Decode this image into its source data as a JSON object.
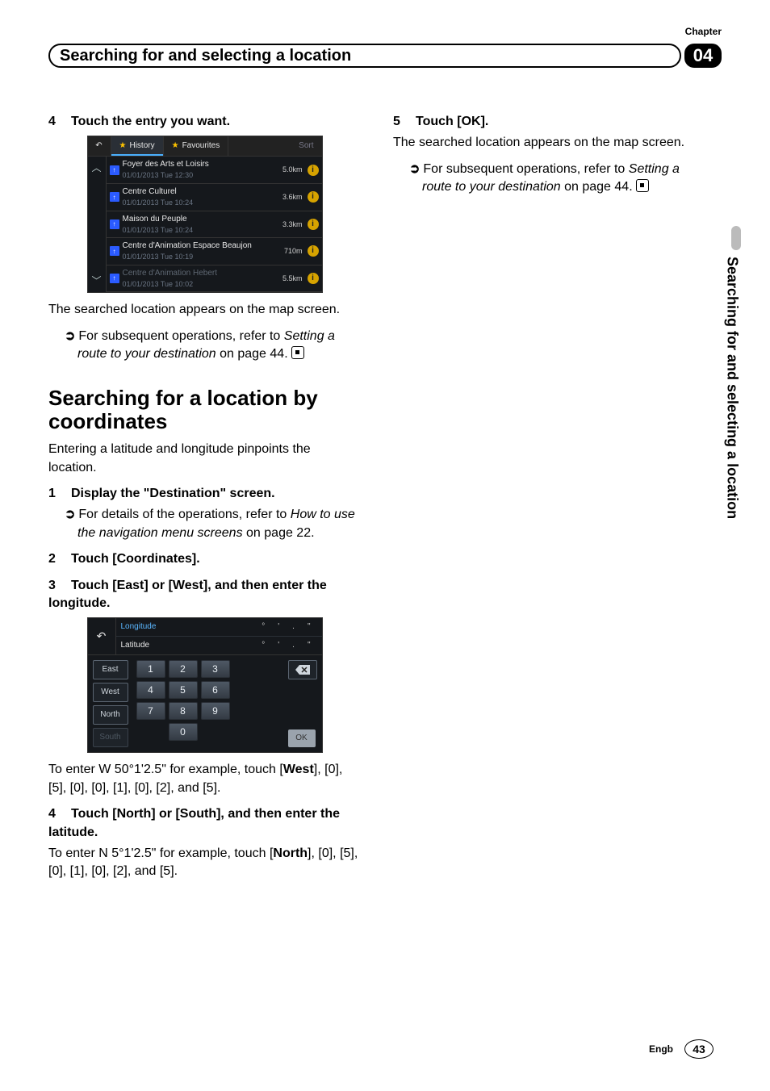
{
  "header": {
    "chapter_label": "Chapter",
    "chapter_number": "04",
    "title": "Searching for and selecting a location"
  },
  "side_tab": "Searching for and selecting a location",
  "step4": {
    "head": "Touch the entry you want.",
    "num": "4"
  },
  "history_ui": {
    "tab_history": "History",
    "tab_favourites": "Favourites",
    "sort": "Sort",
    "rows": [
      {
        "name": "Foyer des Arts et Loisirs",
        "time": "01/01/2013  Tue  12:30",
        "dist": "5.0km"
      },
      {
        "name": "Centre Culturel",
        "time": "01/01/2013  Tue  10:24",
        "dist": "3.6km"
      },
      {
        "name": "Maison du Peuple",
        "time": "01/01/2013  Tue  10:24",
        "dist": "3.3km"
      },
      {
        "name": "Centre d'Animation Espace Beaujon",
        "time": "01/01/2013  Tue  10:19",
        "dist": "710m"
      },
      {
        "name": "Centre d'Animation Hebert",
        "time": "01/01/2013  Tue  10:02",
        "dist": "5.5km"
      }
    ]
  },
  "after_shot1": {
    "body": "The searched location appears on the map screen.",
    "ref_prefix": "For subsequent operations, refer to ",
    "ref_italic": "Setting a route to your destination",
    "ref_suffix": " on page 44."
  },
  "section_heading": "Searching for a location by coordinates",
  "section_body": "Entering a latitude and longitude pinpoints the location.",
  "c_step1": {
    "num": "1",
    "head": "Display the \"Destination\" screen.",
    "ref_prefix": "For details of the operations, refer to ",
    "ref_italic": "How to use the navigation menu screens",
    "ref_suffix": " on page 22."
  },
  "c_step2": {
    "num": "2",
    "head": "Touch [Coordinates]."
  },
  "c_step3": {
    "num": "3",
    "head": "Touch [East] or [West], and then enter the longitude."
  },
  "coord_ui": {
    "longitude": "Longitude",
    "latitude": "Latitude",
    "deg": "°",
    "min": "'",
    "sec": "\"",
    "east": "East",
    "west": "West",
    "north": "North",
    "south": "South",
    "ok": "OK",
    "keys": [
      "1",
      "2",
      "3",
      "4",
      "5",
      "6",
      "7",
      "8",
      "9"
    ],
    "zero": "0"
  },
  "after_shot2_1": "To enter W 50°1'2.5\" for example, touch [",
  "after_shot2_bold": "West",
  "after_shot2_2": "], [0], [5], [0], [0], [1], [0], [2], and [5].",
  "c_step4": {
    "num": "4",
    "head": "Touch [North] or [South], and then enter the latitude."
  },
  "c_step4_body1": "To enter N 5°1'2.5\" for example, touch [",
  "c_step4_bold": "North",
  "c_step4_body2": "], [0], [5], [0], [1], [0], [2], and [5].",
  "right_step5": {
    "num": "5",
    "head": "Touch [OK]."
  },
  "right_body": "The searched location appears on the map screen.",
  "right_ref_prefix": "For subsequent operations, refer to ",
  "right_ref_italic": "Setting a route to your destination",
  "right_ref_suffix": " on page 44.",
  "footer": {
    "lang": "Engb",
    "page": "43"
  }
}
